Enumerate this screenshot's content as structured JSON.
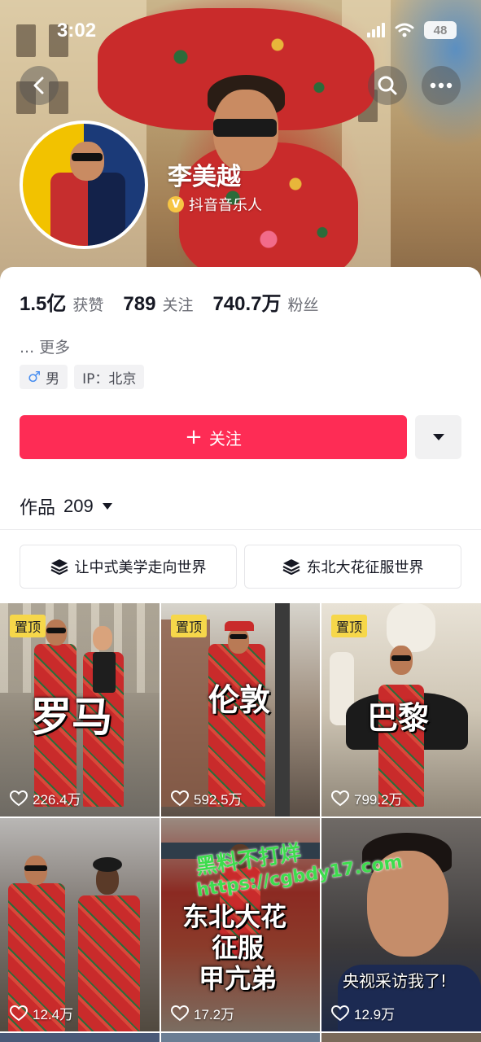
{
  "status_bar": {
    "time": "3:02",
    "battery": "48"
  },
  "profile": {
    "name": "李美越",
    "verification": "抖音音乐人",
    "verification_badge": "V",
    "stats": [
      {
        "value": "1.5亿",
        "label": "获赞"
      },
      {
        "value": "789",
        "label": "关注"
      },
      {
        "value": "740.7万",
        "label": "粉丝"
      }
    ],
    "bio": "... 更多",
    "tags": {
      "gender_symbol": "♂",
      "gender": "男",
      "ip": "IP：北京"
    }
  },
  "actions": {
    "follow_icon": "+",
    "follow_label": "关注",
    "dropdown_icon": "caret-down-icon"
  },
  "works": {
    "label": "作品",
    "count": "209"
  },
  "collections": [
    {
      "label": "让中式美学走向世界",
      "icon": "layers-icon"
    },
    {
      "label": "东北大花征服世界",
      "icon": "layers-icon"
    }
  ],
  "videos": [
    {
      "pinned": "置顶",
      "overlay": "罗马",
      "likes": "226.4万"
    },
    {
      "pinned": "置顶",
      "overlay": "伦敦",
      "likes": "592.5万"
    },
    {
      "pinned": "置顶",
      "overlay": "巴黎",
      "likes": "799.2万"
    },
    {
      "overlay": "",
      "likes": "12.4万"
    },
    {
      "overlay_lines": [
        "东北大花",
        "征服",
        "甲亢弟"
      ],
      "likes": "17.2万"
    },
    {
      "overlay": "央视采访我了!",
      "likes": "12.9万"
    }
  ],
  "watermark": {
    "line1": "黑料不打烊",
    "line2": "https://cgbdy17.com"
  },
  "colors": {
    "accent": "#fe2c55",
    "pin_badge": "#f6d74a",
    "watermark": "#3ddc4d"
  }
}
